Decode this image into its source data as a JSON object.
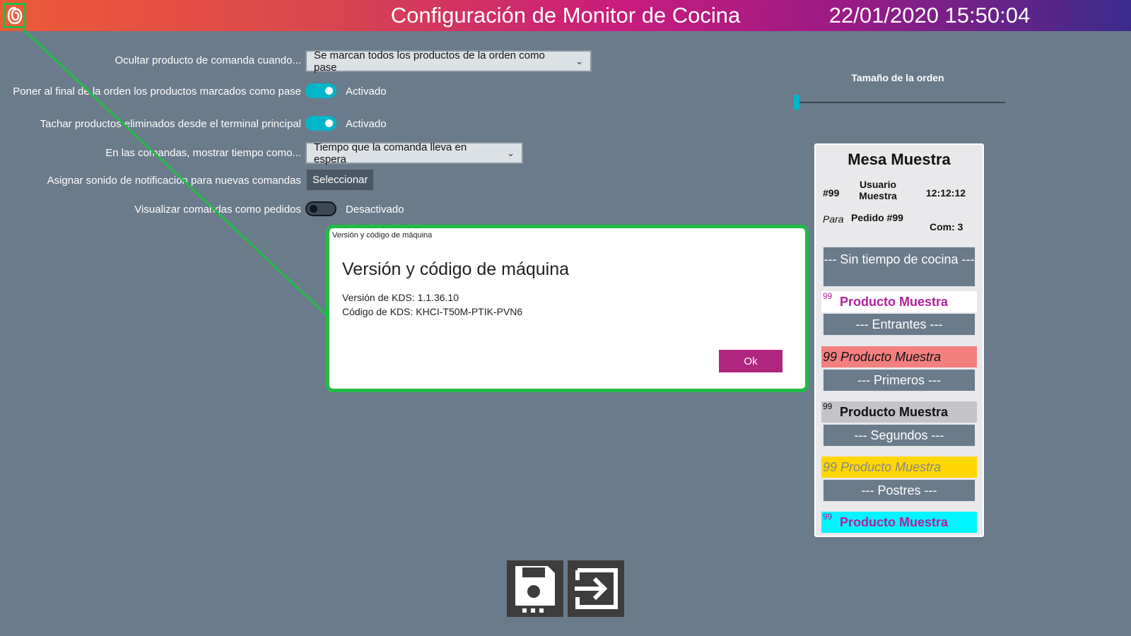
{
  "header": {
    "title": "Configuración de Monitor de Cocina",
    "datetime": "22/01/2020 15:50:04",
    "logo_icon": "app-logo-icon"
  },
  "settings": {
    "hide_product": {
      "label": "Ocultar producto de comanda cuando...",
      "value": "Se marcan todos los productos de la orden como pase"
    },
    "move_to_end": {
      "label": "Poner al final de la orden los productos marcados como pase",
      "state": "Activado"
    },
    "strike_deleted": {
      "label": "Tachar productos eliminados desde el terminal principal",
      "state": "Activado"
    },
    "show_time": {
      "label": "En las comandas, mostrar tiempo como...",
      "value": "Tiempo que la comanda lleva en espera"
    },
    "notification_sound": {
      "label": "Asignar sonido de notificación para nuevas comandas",
      "button": "Seleccionar"
    },
    "show_as_orders": {
      "label": "Visualizar comandas como pedidos",
      "state": "Desactivado"
    }
  },
  "dialog": {
    "caption": "Versión y código de máquina",
    "heading": "Versión y código de máquina",
    "version_line": "Versión de KDS: 1.1.36.10",
    "code_line": "Código de KDS: KHCI-T50M-PTIK-PVN6",
    "ok_label": "Ok"
  },
  "order_size": {
    "label": "Tamaño de la orden",
    "level": 0
  },
  "preview": {
    "title": "Mesa Muestra",
    "number": "#99",
    "user": "Usuario Muestra",
    "time": "12:12:12",
    "para": "Para",
    "order": "Pedido #99",
    "com": "Com: 3",
    "sections": [
      "--- Sin tiempo de cocina ---",
      "--- Entrantes ---",
      "--- Primeros ---",
      "--- Segundos ---",
      "--- Postres ---"
    ],
    "products": [
      {
        "qty": "99",
        "name": "Producto Muestra",
        "bg": "#ffffff",
        "color": "#b0209c"
      },
      {
        "qty": "99",
        "name": "Producto Muestra",
        "bg": "#f47f7f",
        "color": "#111111"
      },
      {
        "qty": "99",
        "name": "Producto Muestra",
        "bg": "#c3c3c8",
        "color": "#111111"
      },
      {
        "qty": "99",
        "name": "Producto Muestra",
        "bg": "#ffd700",
        "color": "#888888"
      },
      {
        "qty": "99",
        "name": "Producto Muestra",
        "bg": "#00f5ff",
        "color": "#b0209c"
      }
    ]
  },
  "footer": {
    "save_icon": "save-icon",
    "exit_icon": "exit-icon"
  },
  "colors": {
    "accent": "#00b6c8",
    "ok_button": "#b0267e",
    "highlight": "#22bb44"
  }
}
